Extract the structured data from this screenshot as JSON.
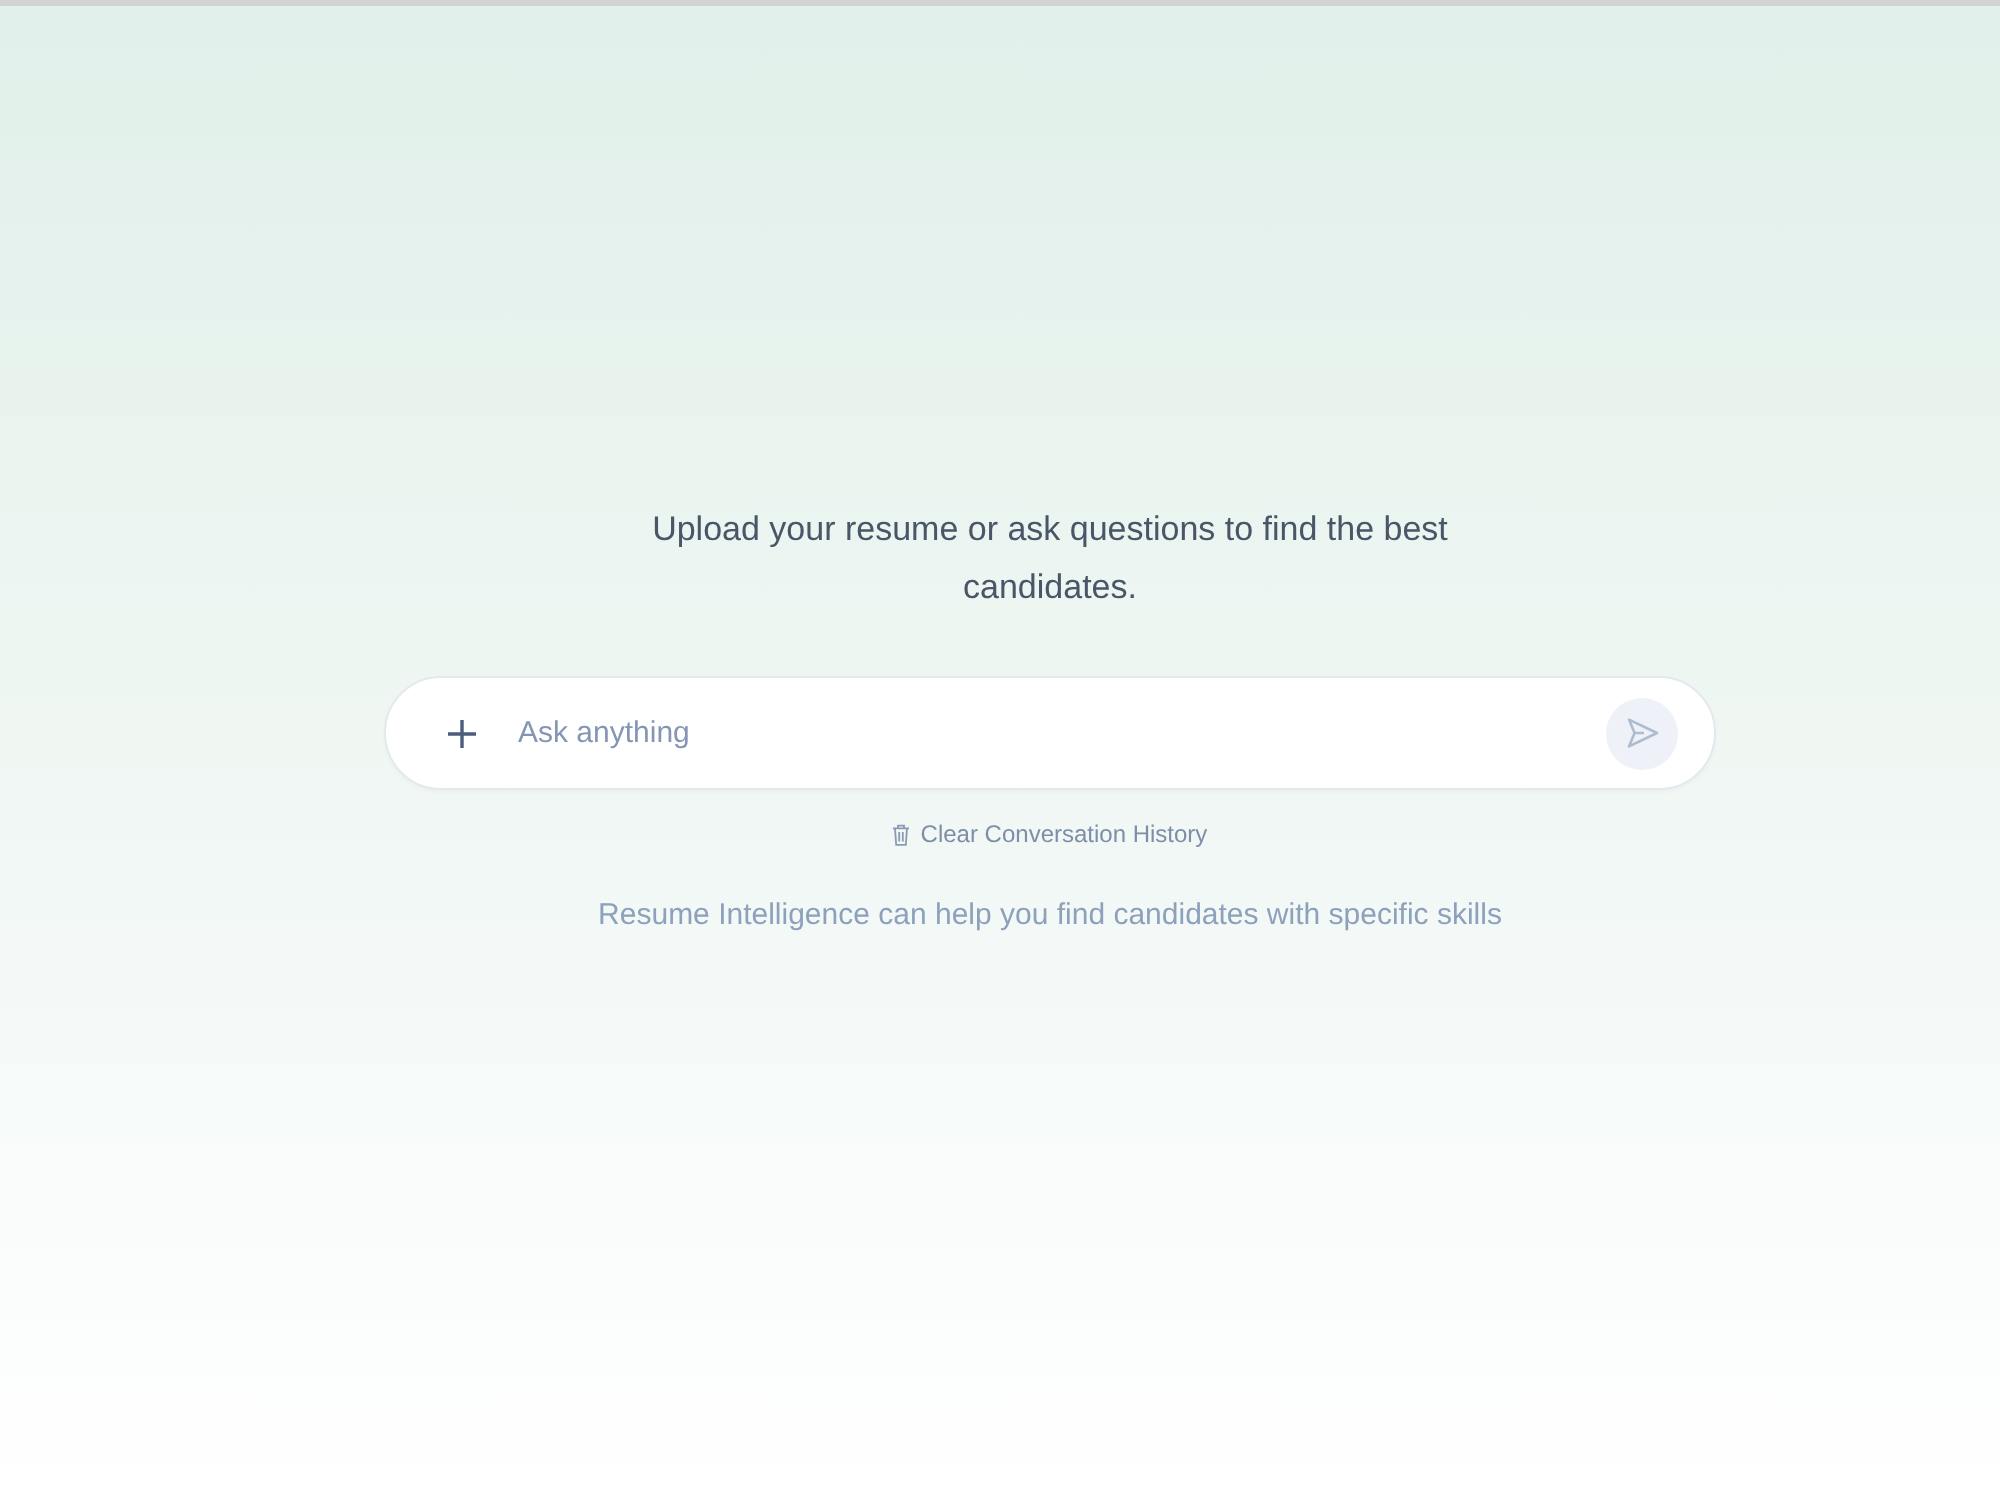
{
  "heading": "Upload your resume or ask questions to find the best candidates.",
  "composer": {
    "placeholder": "Ask anything",
    "send_button": {
      "disabled": true
    }
  },
  "clear_history": {
    "label": "Clear Conversation History"
  },
  "hint": "Resume Intelligence can help you find candidates with specific skills"
}
